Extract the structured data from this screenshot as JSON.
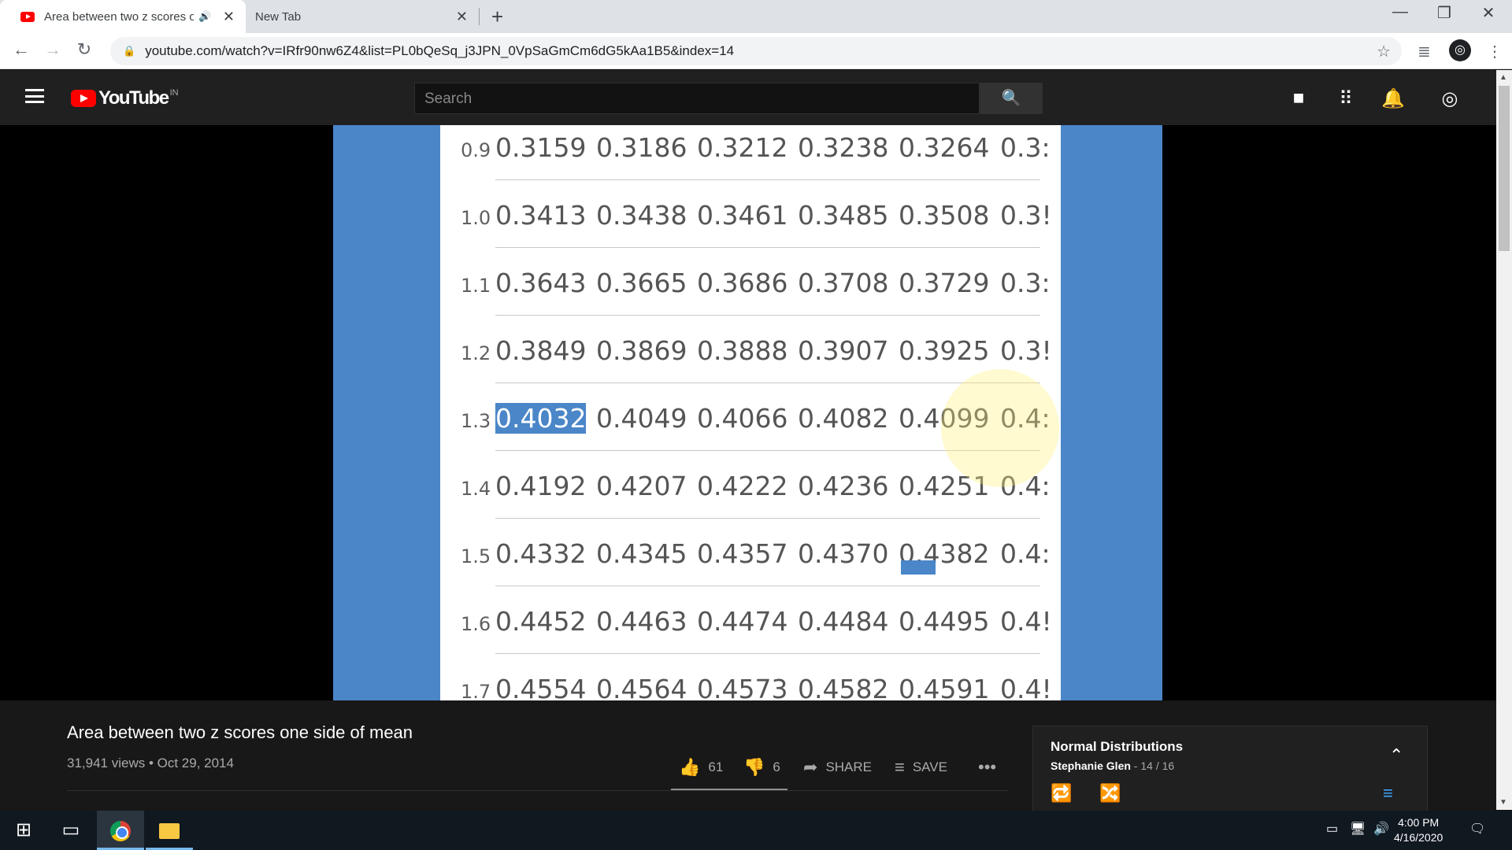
{
  "browser": {
    "tabs": [
      {
        "title": "Area between two z scores o",
        "active": true
      },
      {
        "title": "New Tab",
        "active": false
      }
    ],
    "url": "youtube.com/watch?v=IRfr90nw6Z4&list=PL0bQeSq_j3JPN_0VpSaGmCm6dG5kAa1B5&index=14"
  },
  "youtube": {
    "logo_text": "YouTube",
    "region": "IN",
    "search_placeholder": "Search"
  },
  "table": {
    "rows": [
      {
        "z": "0.9",
        "values": [
          "0.3159",
          "0.3186",
          "0.3212",
          "0.3238",
          "0.3264",
          "0.3:"
        ]
      },
      {
        "z": "1.0",
        "values": [
          "0.3413",
          "0.3438",
          "0.3461",
          "0.3485",
          "0.3508",
          "0.3!"
        ]
      },
      {
        "z": "1.1",
        "values": [
          "0.3643",
          "0.3665",
          "0.3686",
          "0.3708",
          "0.3729",
          "0.3:"
        ]
      },
      {
        "z": "1.2",
        "values": [
          "0.3849",
          "0.3869",
          "0.3888",
          "0.3907",
          "0.3925",
          "0.3!"
        ]
      },
      {
        "z": "1.3",
        "values": [
          "0.4032",
          "0.4049",
          "0.4066",
          "0.4082",
          "0.4099",
          "0.4:"
        ]
      },
      {
        "z": "1.4",
        "values": [
          "0.4192",
          "0.4207",
          "0.4222",
          "0.4236",
          "0.4251",
          "0.4:"
        ]
      },
      {
        "z": "1.5",
        "values": [
          "0.4332",
          "0.4345",
          "0.4357",
          "0.4370",
          "0.4382",
          "0.4:"
        ]
      },
      {
        "z": "1.6",
        "values": [
          "0.4452",
          "0.4463",
          "0.4474",
          "0.4484",
          "0.4495",
          "0.4!"
        ]
      },
      {
        "z": "1.7",
        "values": [
          "0.4554",
          "0.4564",
          "0.4573",
          "0.4582",
          "0.4591",
          "0.4!"
        ]
      }
    ],
    "selected": {
      "row": 4,
      "col": 0
    }
  },
  "video": {
    "title": "Area between two z scores one side of mean",
    "meta": "31,941 views • Oct 29, 2014",
    "likes": "61",
    "dislikes": "6",
    "share_label": "SHARE",
    "save_label": "SAVE"
  },
  "playlist": {
    "title": "Normal Distributions",
    "author": "Stephanie Glen",
    "position": " - 14 / 16"
  },
  "taskbar": {
    "time": "4:00 PM",
    "date": "4/16/2020"
  },
  "colors": {
    "accent_red": "#ff0000",
    "slide_blue": "#4a86c8"
  }
}
